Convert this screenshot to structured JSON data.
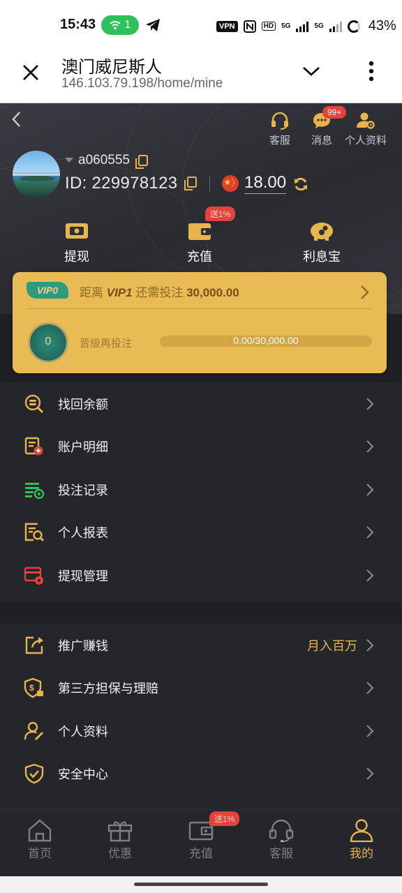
{
  "status": {
    "time": "15:43",
    "wifi_count": "1",
    "vpn": "VPN",
    "hd": "HD",
    "net1": "5G",
    "net2": "5G",
    "battery": "43%"
  },
  "browser": {
    "title": "澳门威尼斯人",
    "url": "146.103.79.198/home/mine"
  },
  "header": {
    "support": "客服",
    "messages": "消息",
    "messages_badge": "99+",
    "profile": "个人资料"
  },
  "user": {
    "username": "a060555",
    "id": "ID: 229978123",
    "balance": "18.00"
  },
  "actions": {
    "withdraw": "提现",
    "deposit": "充值",
    "deposit_badge": "送1%",
    "interest": "利息宝"
  },
  "vip": {
    "tag": "VIP0",
    "line_prefix": "距离",
    "next_level": "VIP1",
    "line_mid": "还需投注",
    "required": "30,000.00",
    "medal_level": "0",
    "upgrade_label": "晋级再投注",
    "progress_text": "0.00/30,000.00",
    "progress_fraction": 0
  },
  "menu1": [
    {
      "label": "找回余额",
      "icon": "coin-search-icon"
    },
    {
      "label": "账户明细",
      "icon": "account-detail-icon"
    },
    {
      "label": "投注记录",
      "icon": "bet-record-icon"
    },
    {
      "label": "个人报表",
      "icon": "report-search-icon"
    },
    {
      "label": "提现管理",
      "icon": "withdraw-manage-icon"
    }
  ],
  "menu2": [
    {
      "label": "推广赚钱",
      "extra": "月入百万",
      "icon": "share-icon"
    },
    {
      "label": "第三方担保与理赔",
      "icon": "guarantee-shield-icon"
    },
    {
      "label": "个人资料",
      "icon": "user-edit-icon"
    },
    {
      "label": "安全中心",
      "icon": "shield-check-icon"
    }
  ],
  "nav": {
    "home": "首页",
    "promo": "优惠",
    "deposit": "充值",
    "deposit_badge": "送1%",
    "support": "客服",
    "mine": "我的"
  },
  "colors": {
    "accent": "#e7b54c",
    "background": "#25262c",
    "vip_card": "#e9bb55",
    "badge_red": "#e6413b"
  }
}
